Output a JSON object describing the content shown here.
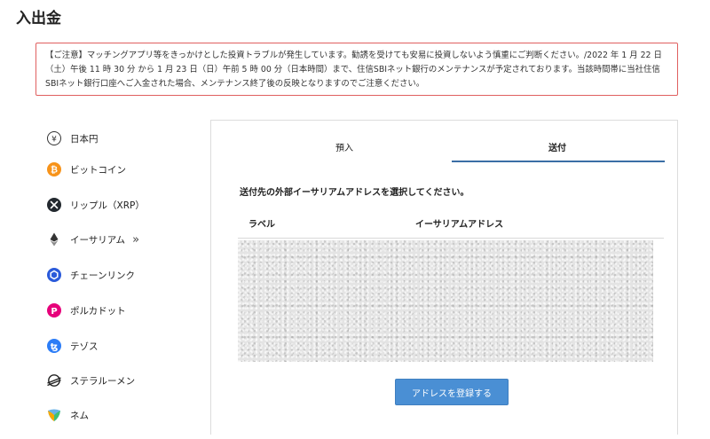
{
  "page": {
    "title": "入出金"
  },
  "notice": {
    "text": "【ご注意】マッチングアプリ等をきっかけとした投資トラブルが発生しています。勧誘を受けても安易に投資しないよう慎重にご判断ください。/2022 年 1 月 22 日（土）午後 11 時 30 分 から 1 月 23 日（日）午前 5 時 00 分（日本時間）まで、住信SBIネット銀行のメンテナンスが予定されております。当該時間帯に当社住信SBIネット銀行口座へご入金された場合、メンテナンス終了後の反映となりますのでご注意ください。",
    "border_color": "#e06060"
  },
  "sidebar": {
    "items": [
      {
        "label": "日本円",
        "icon": "yen-icon"
      },
      {
        "label": "ビットコイン",
        "icon": "bitcoin-icon",
        "color": "#f7931a"
      },
      {
        "label": "リップル（XRP）",
        "icon": "xrp-icon",
        "color": "#23292f"
      },
      {
        "label": "イーサリアム",
        "icon": "ethereum-icon",
        "chevron": "»"
      },
      {
        "label": "チェーンリンク",
        "icon": "chainlink-icon",
        "color": "#2a5ada"
      },
      {
        "label": "ポルカドット",
        "icon": "polkadot-icon",
        "color": "#e6007a"
      },
      {
        "label": "テゾス",
        "icon": "tezos-icon",
        "color": "#2c7df7"
      },
      {
        "label": "ステラルーメン",
        "icon": "stellar-icon"
      },
      {
        "label": "ネム",
        "icon": "nem-icon"
      }
    ]
  },
  "tabs": {
    "deposit": "預入",
    "send": "送付",
    "active_color": "#3a6ea5"
  },
  "send_panel": {
    "instruction": "送付先の外部イーサリアムアドレスを選択してください。",
    "columns": {
      "label": "ラベル",
      "address": "イーサリアムアドレス"
    },
    "register_button": "アドレスを登録する",
    "button_color": "#4a8fd4"
  }
}
